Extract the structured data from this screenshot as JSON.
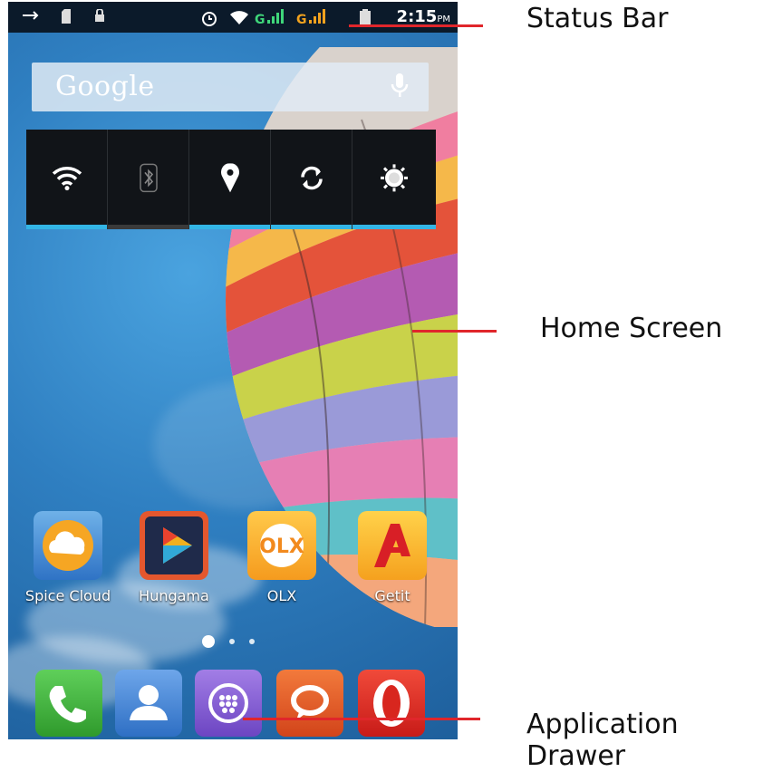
{
  "status_bar": {
    "time": "2:15",
    "time_suffix": "PM",
    "left_icons": [
      "usb-icon",
      "sd-card-icon",
      "lock-icon"
    ],
    "right_icons": [
      "alarm-icon",
      "wifi-icon",
      "signal-g-icon",
      "signal-g-icon",
      "battery-icon"
    ]
  },
  "search": {
    "label": "Google"
  },
  "toggles": [
    {
      "name": "wifi-icon",
      "state": "on"
    },
    {
      "name": "bluetooth-icon",
      "state": "off"
    },
    {
      "name": "location-icon",
      "state": "on"
    },
    {
      "name": "sync-icon",
      "state": "on"
    },
    {
      "name": "brightness-icon",
      "state": "on"
    }
  ],
  "apps": [
    {
      "label": "Spice Cloud",
      "icon": "cloud-icon"
    },
    {
      "label": "Hungama",
      "icon": "play-icon"
    },
    {
      "label": "OLX",
      "icon": "olx-icon"
    },
    {
      "label": "Getit",
      "icon": "getit-icon"
    }
  ],
  "page_indicator": {
    "pages": 3,
    "current": 1
  },
  "dock": [
    {
      "icon": "phone-icon",
      "color": "#3aa13a"
    },
    {
      "icon": "contacts-icon",
      "color": "#3c7fd1"
    },
    {
      "icon": "app-drawer-icon",
      "color": "#8a5bd4"
    },
    {
      "icon": "messaging-icon",
      "color": "#e05a1e"
    },
    {
      "icon": "opera-icon",
      "color": "#d8261e"
    }
  ],
  "annotations": {
    "status_bar": "Status Bar",
    "home_screen": "Home Screen",
    "app_drawer": "Application Drawer"
  },
  "colors": {
    "toggle_active": "#33b5e5",
    "annotation_line": "#e0262b"
  }
}
